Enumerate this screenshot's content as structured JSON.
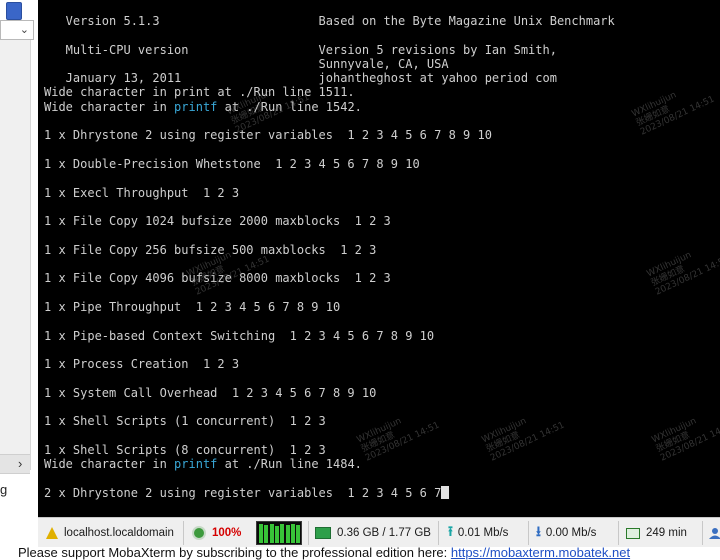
{
  "left_strip": {
    "dropdown_arrow": "⌄",
    "expand_symbol": "›",
    "partial_letter": "g"
  },
  "terminal": {
    "lines": [
      {
        "type": "text",
        "text": "   Version 5.1.3                      Based on the Byte Magazine Unix Benchmark"
      },
      {
        "type": "text",
        "text": ""
      },
      {
        "type": "text",
        "text": "   Multi-CPU version                  Version 5 revisions by Ian Smith,"
      },
      {
        "type": "text",
        "text": "                                      Sunnyvale, CA, USA"
      },
      {
        "type": "text",
        "text": "   January 13, 2011                   johantheghost at yahoo period com"
      },
      {
        "type": "split",
        "before": "Wide character in print at ./Run line 1511.",
        "highlight": "",
        "after": ""
      },
      {
        "type": "split",
        "before": "Wide character in ",
        "highlight": "printf",
        "after": " at ./Run line 1542."
      },
      {
        "type": "text",
        "text": ""
      },
      {
        "type": "text",
        "text": "1 x Dhrystone 2 using register variables  1 2 3 4 5 6 7 8 9 10"
      },
      {
        "type": "text",
        "text": ""
      },
      {
        "type": "text",
        "text": "1 x Double-Precision Whetstone  1 2 3 4 5 6 7 8 9 10"
      },
      {
        "type": "text",
        "text": ""
      },
      {
        "type": "text",
        "text": "1 x Execl Throughput  1 2 3"
      },
      {
        "type": "text",
        "text": ""
      },
      {
        "type": "text",
        "text": "1 x File Copy 1024 bufsize 2000 maxblocks  1 2 3"
      },
      {
        "type": "text",
        "text": ""
      },
      {
        "type": "text",
        "text": "1 x File Copy 256 bufsize 500 maxblocks  1 2 3"
      },
      {
        "type": "text",
        "text": ""
      },
      {
        "type": "text",
        "text": "1 x File Copy 4096 bufsize 8000 maxblocks  1 2 3"
      },
      {
        "type": "text",
        "text": ""
      },
      {
        "type": "text",
        "text": "1 x Pipe Throughput  1 2 3 4 5 6 7 8 9 10"
      },
      {
        "type": "text",
        "text": ""
      },
      {
        "type": "text",
        "text": "1 x Pipe-based Context Switching  1 2 3 4 5 6 7 8 9 10"
      },
      {
        "type": "text",
        "text": ""
      },
      {
        "type": "text",
        "text": "1 x Process Creation  1 2 3"
      },
      {
        "type": "text",
        "text": ""
      },
      {
        "type": "text",
        "text": "1 x System Call Overhead  1 2 3 4 5 6 7 8 9 10"
      },
      {
        "type": "text",
        "text": ""
      },
      {
        "type": "text",
        "text": "1 x Shell Scripts (1 concurrent)  1 2 3"
      },
      {
        "type": "text",
        "text": ""
      },
      {
        "type": "text",
        "text": "1 x Shell Scripts (8 concurrent)  1 2 3"
      },
      {
        "type": "split",
        "before": "Wide character in ",
        "highlight": "printf",
        "after": " at ./Run line 1484."
      },
      {
        "type": "text",
        "text": ""
      },
      {
        "type": "cursor",
        "text": "2 x Dhrystone 2 using register variables  1 2 3 4 5 6 7"
      }
    ]
  },
  "status_bar": {
    "host": "localhost.localdomain",
    "host_icon": "linux-tux-icon",
    "cpu_percent": "100%",
    "cpu_bars": [
      0.95,
      0.9,
      0.95,
      0.85,
      0.95,
      0.9,
      0.95,
      0.92
    ],
    "memory": "0.36 GB / 1.77 GB",
    "upload": "0.01 Mb/s",
    "download": "0.00 Mb/s",
    "uptime": "249 min",
    "upload_icon": "upload-arrow-icon",
    "download_icon": "download-arrow-icon",
    "colors": {
      "cpu_text": "#d40000",
      "graph_bar": "#38c438",
      "highlight": "#39a7d6"
    }
  },
  "bottom": {
    "text": "Please support MobaXterm by subscribing to the professional edition here:",
    "link": "https://mobaxterm.mobatek.net"
  },
  "watermark": {
    "name": "WXlihuijun",
    "cn": "张姗如意",
    "date": "2023/08/21 14:51"
  }
}
